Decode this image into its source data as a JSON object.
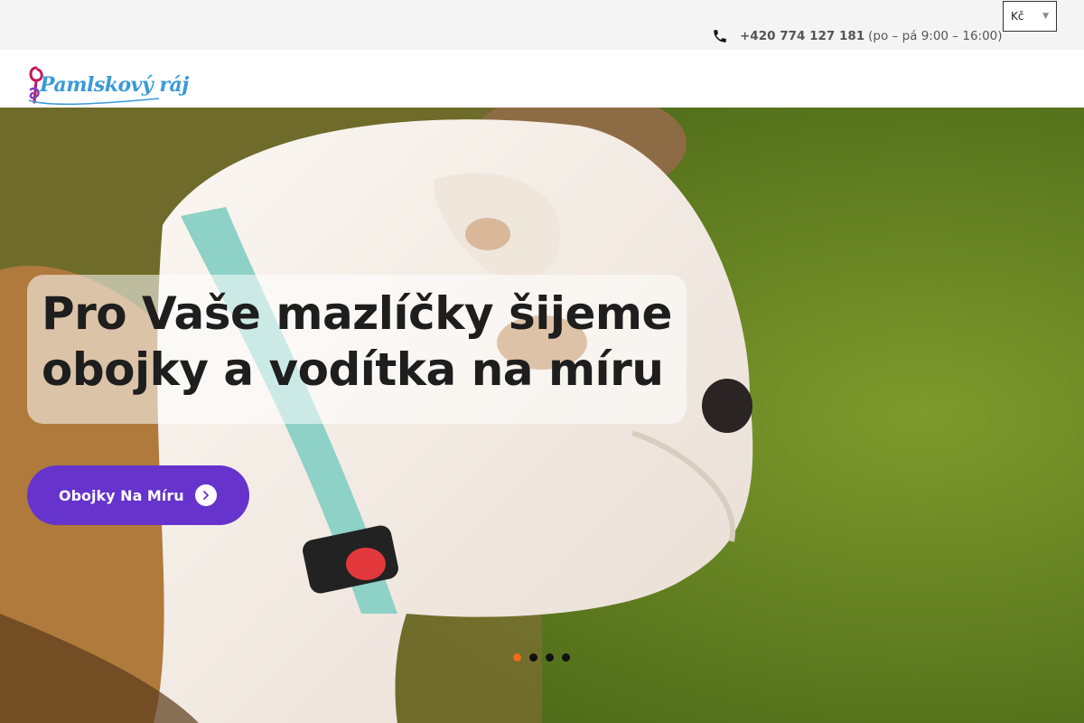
{
  "topbar": {
    "phone_number": "+420 774 127 181",
    "phone_hours": "(po – pá 9:00 – 16:00)",
    "icon": "phone-icon"
  },
  "currency": {
    "selected": "Kč",
    "icon": "chevron-down-icon"
  },
  "header": {
    "logo_text": "Pamlskový ráj",
    "logo_colors": [
      "#3a9ad6",
      "#c2185b",
      "#7b3fc4"
    ]
  },
  "hero": {
    "headline": "Pro Vaše mazlíčky šijeme obojky a vodítka na míru",
    "cta_label": "Obojky Na Míru",
    "cta_icon": "chevron-right-icon",
    "cta_color": "#6633cc",
    "slides": [
      {
        "label": "Slide 1",
        "active": true
      },
      {
        "label": "Slide 2",
        "active": false
      },
      {
        "label": "Slide 3",
        "active": false
      },
      {
        "label": "Slide 4",
        "active": false
      }
    ],
    "active_dot_color": "#ee6b1f"
  }
}
